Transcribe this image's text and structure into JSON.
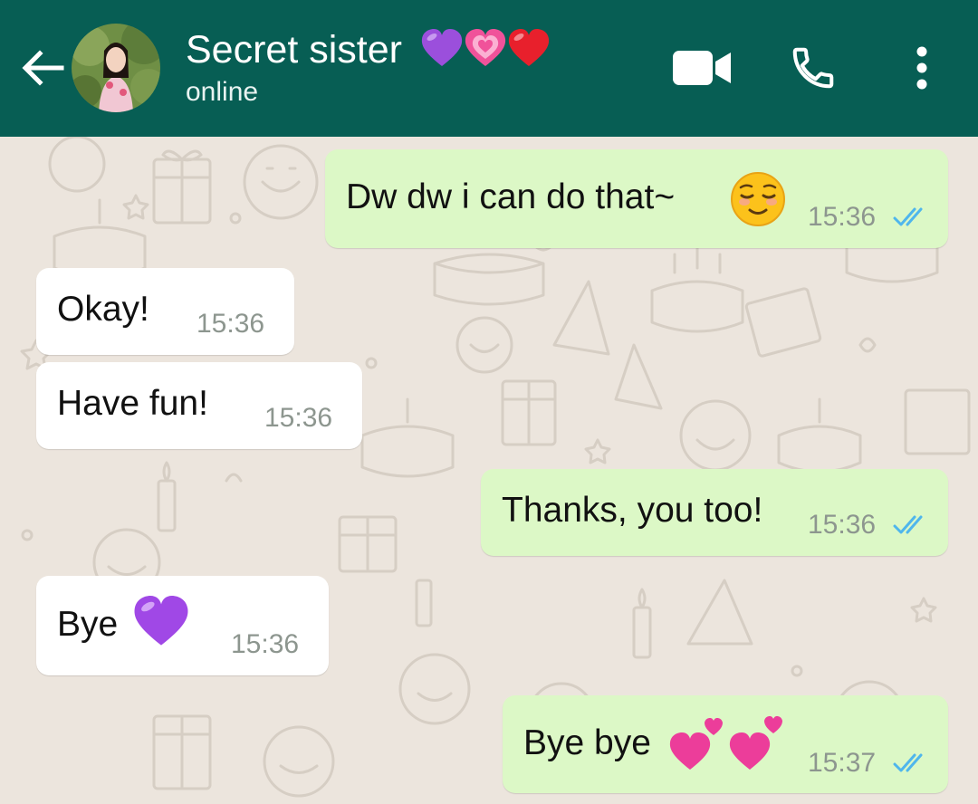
{
  "header": {
    "contact_name": "Secret sister",
    "name_emojis": [
      "purple-heart",
      "growing-heart",
      "red-heart"
    ],
    "status": "online",
    "icons": [
      "arrow-left",
      "video-camera",
      "phone",
      "more-vertical"
    ]
  },
  "messages": [
    {
      "direction": "outgoing",
      "text": "Dw dw i can do that~",
      "emoji": "relieved-face",
      "time": "15:36",
      "read": true
    },
    {
      "direction": "incoming",
      "text": "Okay!",
      "time": "15:36"
    },
    {
      "direction": "incoming",
      "text": "Have fun!",
      "time": "15:36"
    },
    {
      "direction": "outgoing",
      "text": "Thanks, you too!",
      "time": "15:36",
      "read": true
    },
    {
      "direction": "incoming",
      "text": "Bye",
      "emoji": "purple-heart",
      "time": "15:36"
    },
    {
      "direction": "outgoing",
      "text": "Bye bye",
      "emoji": "two-hearts",
      "time": "15:37",
      "read": true
    }
  ],
  "colors": {
    "header": "#075e54",
    "wallpaper": "#ece5dd",
    "outgoing_bubble": "#dcf8c6",
    "incoming_bubble": "#ffffff",
    "read_ticks": "#4fb6ec",
    "timestamp": "#8d968f"
  }
}
